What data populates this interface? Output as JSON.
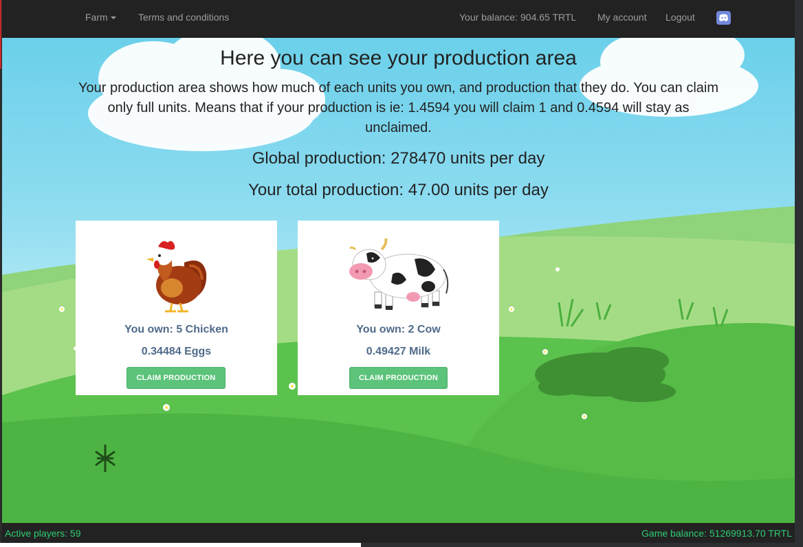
{
  "nav": {
    "farm_label": "Farm",
    "terms_label": "Terms and conditions",
    "balance_text": "Your balance: 904.65 TRTL",
    "account_label": "My account",
    "logout_label": "Logout",
    "discord_icon": "discord-icon"
  },
  "page": {
    "title": "Here you can see your production area",
    "intro": "Your production area shows how much of each units you own, and production that they do. You can claim only full units. Means that if your production is ie: 1.4594 you will claim 1 and 0.4594 will stay as unclaimed.",
    "global_production": "Global production: 278470 units per day",
    "total_production": "Your total production: 47.00 units per day"
  },
  "cards": [
    {
      "icon": "chicken-icon",
      "own_text": "You own: 5 Chicken",
      "amount_text": "0.34484 Eggs",
      "button_label": "CLAIM PRODUCTION"
    },
    {
      "icon": "cow-icon",
      "own_text": "You own: 2 Cow",
      "amount_text": "0.49427 Milk",
      "button_label": "CLAIM PRODUCTION"
    }
  ],
  "footer": {
    "active_players": "Active players: 59",
    "game_balance": "Game balance: 51269913.70 TRTL"
  },
  "colors": {
    "navbar": "#222222",
    "button": "#5cc37a",
    "footer_text": "#2ecc71",
    "card_text": "#4f6a8a"
  }
}
